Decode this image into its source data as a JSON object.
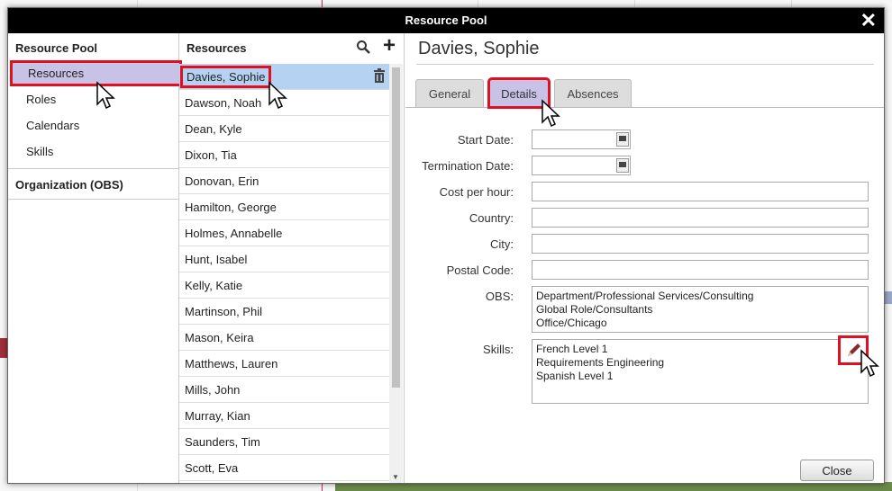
{
  "dialog": {
    "title": "Resource Pool",
    "close_glyph": "✕"
  },
  "nav": {
    "header": "Resource Pool",
    "items": [
      {
        "label": "Resources",
        "selected": true
      },
      {
        "label": "Roles"
      },
      {
        "label": "Calendars"
      },
      {
        "label": "Skills"
      }
    ],
    "section2": "Organization (OBS)"
  },
  "resources": {
    "header": "Resources",
    "search_icon": "search-icon",
    "add_icon": "plus-icon",
    "add_glyph": "+",
    "items": [
      "Davies, Sophie",
      "Dawson, Noah",
      "Dean, Kyle",
      "Dixon, Tia",
      "Donovan, Erin",
      "Hamilton, George",
      "Holmes, Annabelle",
      "Hunt, Isabel",
      "Kelly, Katie",
      "Martinson, Phil",
      "Mason, Keira",
      "Matthews, Lauren",
      "Mills, John",
      "Murray, Kian",
      "Saunders, Tim",
      "Scott, Eva"
    ],
    "selected": "Davies, Sophie"
  },
  "detail": {
    "name": "Davies, Sophie",
    "tabs": [
      "General",
      "Details",
      "Absences"
    ],
    "active_tab": "Details",
    "fields": {
      "start_date": {
        "label": "Start Date:",
        "value": ""
      },
      "termination_date": {
        "label": "Termination Date:",
        "value": ""
      },
      "cost_per_hour": {
        "label": "Cost per hour:",
        "value": ""
      },
      "country": {
        "label": "Country:",
        "value": ""
      },
      "city": {
        "label": "City:",
        "value": ""
      },
      "postal_code": {
        "label": "Postal Code:",
        "value": ""
      },
      "obs": {
        "label": "OBS:",
        "lines": [
          "Department/Professional Services/Consulting",
          "Global Role/Consultants",
          "Office/Chicago"
        ]
      },
      "skills": {
        "label": "Skills:",
        "lines": [
          "French Level 1",
          "Requirements Engineering",
          "Spanish Level 1"
        ]
      }
    },
    "close_label": "Close"
  },
  "colors": {
    "highlight": "#e01020",
    "selection": "#c8c3e6",
    "list_selection": "#b6d2f3"
  }
}
